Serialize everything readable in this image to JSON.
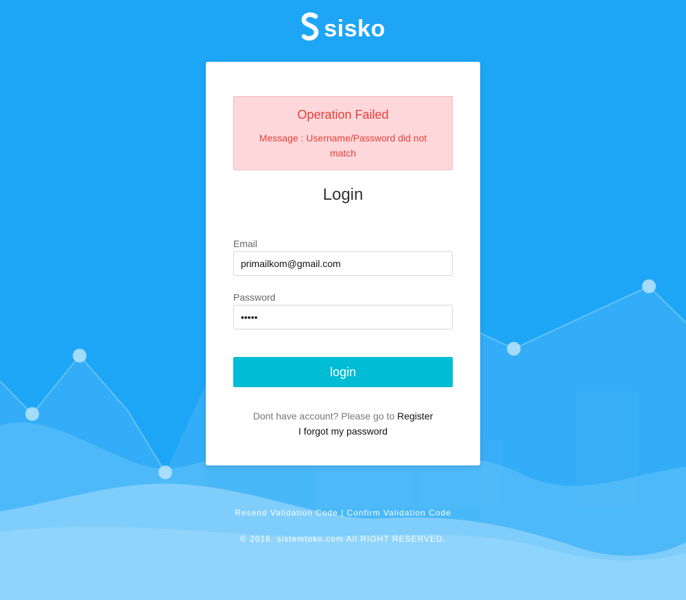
{
  "brand": {
    "name": "sisko",
    "logo_icon": "s-logo-icon"
  },
  "alert": {
    "title": "Operation Failed",
    "message": "Message : Username/Password did not match"
  },
  "login": {
    "title": "Login",
    "email_label": "Email",
    "email_value": "primailkom@gmail.com",
    "password_label": "Password",
    "password_value": "aaaaa",
    "button_label": "login",
    "register_prompt": "Dont have account? Please go to",
    "register_link": "Register",
    "forgot_link": "I forgot my password"
  },
  "footer": {
    "resend_link": "Resend Validation Code",
    "separator": "|",
    "confirm_link": "Confirm Validation Code",
    "copyright": "© 2016. sistemtoko.com All RIGHT RESERVED."
  },
  "colors": {
    "background": "#1ea6f6",
    "button": "#00bcd4",
    "alert_bg": "#fdd7da",
    "alert_text": "#e6403a"
  }
}
